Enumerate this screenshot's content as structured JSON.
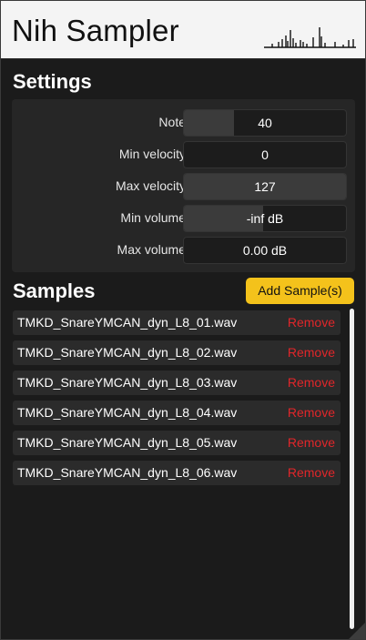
{
  "app": {
    "title": "Nih Sampler",
    "waveform_icon": "waveform-icon"
  },
  "settings": {
    "heading": "Settings",
    "rows": [
      {
        "label": "Note",
        "value": "40",
        "fill_fraction": 0.31
      },
      {
        "label": "Min velocity",
        "value": "0",
        "fill_fraction": 0.0
      },
      {
        "label": "Max velocity",
        "value": "127",
        "fill_fraction": 1.0
      },
      {
        "label": "Min volume",
        "value": "-inf dB",
        "fill_fraction": 0.49
      },
      {
        "label": "Max volume",
        "value": "0.00 dB",
        "fill_fraction": 0.0
      }
    ]
  },
  "samples": {
    "heading": "Samples",
    "add_label": "Add Sample(s)",
    "remove_label": "Remove",
    "items": [
      "TMKD_SnareYMCAN_dyn_L8_01.wav",
      "TMKD_SnareYMCAN_dyn_L8_02.wav",
      "TMKD_SnareYMCAN_dyn_L8_03.wav",
      "TMKD_SnareYMCAN_dyn_L8_04.wav",
      "TMKD_SnareYMCAN_dyn_L8_05.wav",
      "TMKD_SnareYMCAN_dyn_L8_06.wav"
    ]
  },
  "colors": {
    "accent": "#f4c21b",
    "remove": "#e0262a",
    "background": "#1b1b1b",
    "panel": "#262626"
  }
}
